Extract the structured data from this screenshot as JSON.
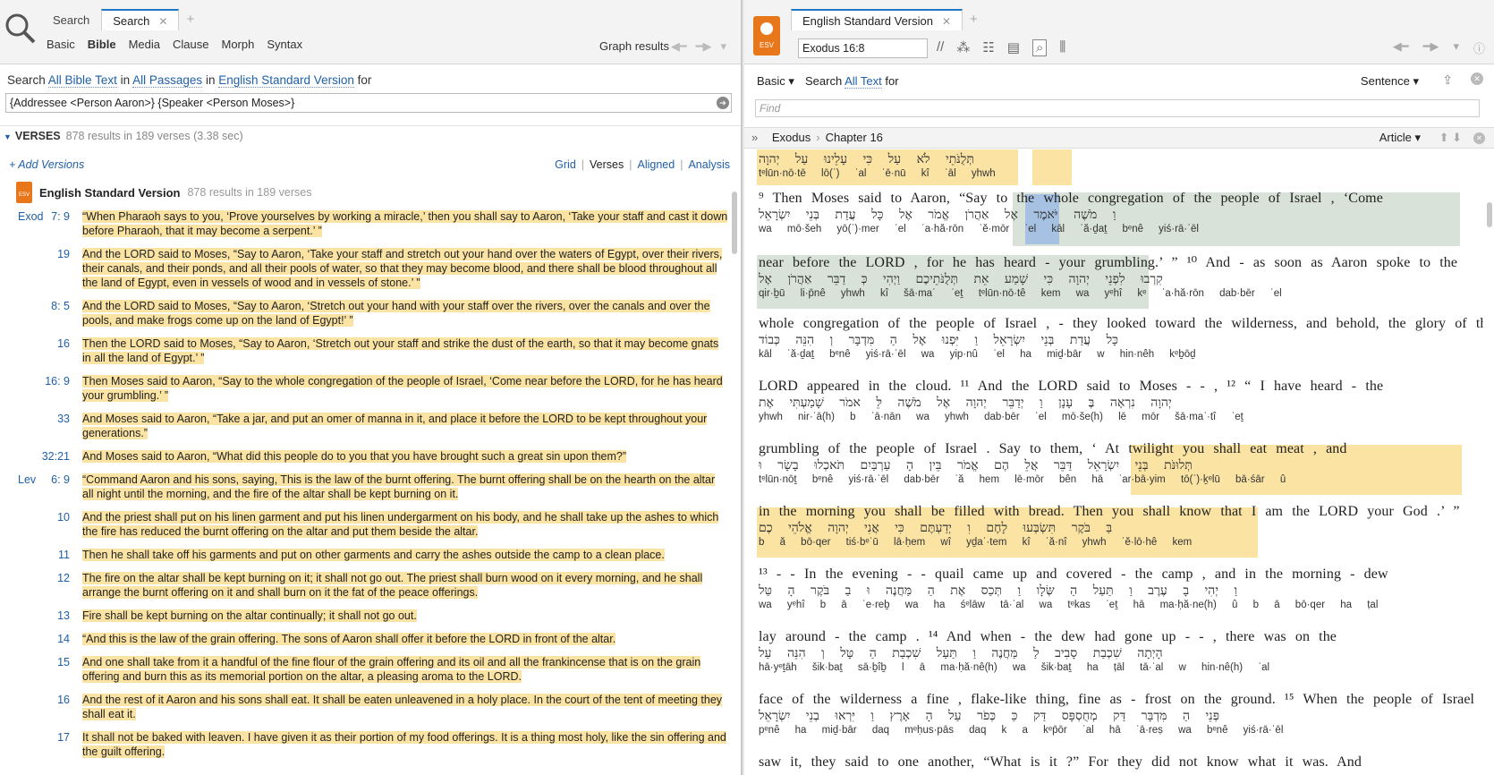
{
  "left": {
    "tabs": [
      {
        "label": "Search"
      },
      {
        "label": "Search",
        "active": true
      }
    ],
    "subnav": [
      "Basic",
      "Bible",
      "Media",
      "Clause",
      "Morph",
      "Syntax"
    ],
    "graph_results": "Graph results",
    "search_line": {
      "pre": "Search",
      "scope": "All Bible Text",
      "in": "in",
      "passages": "All Passages",
      "in2": "in",
      "version": "English Standard Version",
      "post": "for"
    },
    "query": "{Addressee <Person Aaron>} {Speaker <Person Moses>}",
    "results_header": {
      "label": "VERSES",
      "summary": "878 results in 189 verses (3.38 sec)"
    },
    "add_versions": "+ Add Versions",
    "view_modes": [
      "Grid",
      "Verses",
      "Aligned",
      "Analysis"
    ],
    "version_name": "English Standard Version",
    "version_meta": "878 results in 189 verses",
    "verses": [
      {
        "book": "Exod",
        "ref": "7: 9",
        "text": "“When Pharaoh says to you, ‘Prove yourselves by working a miracle,’ then you shall say to Aaron, ‘Take your staff and cast it down before Pharaoh, that it may become a serpent.’ ”"
      },
      {
        "book": "",
        "ref": "19",
        "text": "And the LORD said to Moses, “Say to Aaron, ‘Take your staff and stretch out your hand over the waters of Egypt, over their rivers, their canals, and their ponds, and all their pools of water, so that they may become blood, and there shall be blood throughout all the land of Egypt, even in vessels of wood and in vessels of stone.’ ”"
      },
      {
        "book": "",
        "ref": "8: 5",
        "text": "And the LORD said to Moses, “Say to Aaron, ‘Stretch out your hand with your staff over the rivers, over the canals and over the pools, and make frogs come up on the land of Egypt!’ ”"
      },
      {
        "book": "",
        "ref": "16",
        "text": "Then the LORD said to Moses, “Say to Aaron, ‘Stretch out your staff and strike the dust of the earth, so that it may become gnats in all the land of Egypt.’ ”"
      },
      {
        "book": "",
        "ref": "16: 9",
        "text": "Then Moses said to Aaron, “Say to the whole congregation of the people of Israel, ‘Come near before the LORD, for he has heard your grumbling.’ ”"
      },
      {
        "book": "",
        "ref": "33",
        "text": "And Moses said to Aaron, “Take a jar, and put an omer of manna in it, and place it before the LORD to be kept throughout your generations.”"
      },
      {
        "book": "",
        "ref": "32:21",
        "text": "And Moses said to Aaron, “What did this people do to you that you have brought such a great sin upon them?”"
      },
      {
        "book": "Lev",
        "ref": "6: 9",
        "text": "“Command Aaron and his sons, saying, This is the law of the burnt offering. The burnt offering shall be on the hearth on the altar all night until the morning, and the fire of the altar shall be kept burning on it."
      },
      {
        "book": "",
        "ref": "10",
        "text": "And the priest shall put on his linen garment and put his linen undergarment on his body, and he shall take up the ashes to which the fire has reduced the burnt offering on the altar and put them beside the altar."
      },
      {
        "book": "",
        "ref": "11",
        "text": "Then he shall take off his garments and put on other garments and carry the ashes outside the camp to a clean place."
      },
      {
        "book": "",
        "ref": "12",
        "text": "The fire on the altar shall be kept burning on it; it shall not go out. The priest shall burn wood on it every morning, and he shall arrange the burnt offering on it and shall burn on it the fat of the peace offerings."
      },
      {
        "book": "",
        "ref": "13",
        "text": "Fire shall be kept burning on the altar continually; it shall not go out."
      },
      {
        "book": "",
        "ref": "14",
        "text": "“And this is the law of the grain offering. The sons of Aaron shall offer it before the LORD in front of the altar."
      },
      {
        "book": "",
        "ref": "15",
        "text": "And one shall take from it a handful of the fine flour of the grain offering and its oil and all the frankincense that is on the grain offering and burn this as its memorial portion on the altar, a pleasing aroma to the LORD."
      },
      {
        "book": "",
        "ref": "16",
        "text": "And the rest of it Aaron and his sons shall eat. It shall be eaten unleavened in a holy place. In the court of the tent of meeting they shall eat it."
      },
      {
        "book": "",
        "ref": "17",
        "text": "It shall not be baked with leaven. I have given it as their portion of my food offerings. It is a thing most holy, like the sin offering and the guilt offering."
      }
    ]
  },
  "right": {
    "tab": "English Standard Version",
    "badge": "ESV",
    "reference": "Exodus 16:8",
    "basic": "Basic ▾",
    "search_pre": "Search",
    "search_scope": "All Text",
    "search_post": "for",
    "sentence": "Sentence ▾",
    "find_placeholder": "Find",
    "breadcrumb": {
      "book": "Exodus",
      "chapter": "Chapter 16"
    },
    "article": "Article ▾",
    "lines": [
      {
        "eng": "",
        "heb": "תְּלֻנֹּתֵי  לֹא  עַל  כִּי  עָלֵינוּ  עַל  יְהוָה",
        "trn": "tᵉlūn·nō·tē   lō(ʾ)   ʿal   ʾē·nū  kî   ʿāl   yhwh"
      },
      {
        "eng": "⁹ Then Moses  said  to  Aaron, “Say  to  the whole congregation of the people of  Israel , ‘Come",
        "heb": "וַ  מֹשֶׁה  יֹּאמֶר  אֶל  אַהֲרֹן  אֱמֹר  אֶל  כָּל  עֲדַת  בְּנֵי  יִשְׂרָאֵל",
        "trn": "wa  mō·šeh  yō(ʾ)·mer  ʾel  ʾa·hă·rōn  ʾĕ·mōr  ʾel  kāl  ʿă·ḏaṯ  bᵉnê  yiś·rā·ʾēl"
      },
      {
        "eng": "near  before  the  LORD , for he has heard  -  your grumbling.’ ” ¹⁰ And  -  as soon as Aaron spoke  to  the",
        "heb": "קִרְבוּ  לִפְנֵי  יְהוָה  כִּי  שָׁמַע  אֵת  תְּלֻנֹּתֵיכֶם  וַיְהִי  כְּ  דַבֵּר  אַהֲרֹן  אֶל",
        "trn": "qir·ḇū  li·p̄nê  yhwh  kî  šā·maʿ  ʾeṯ  tᵉlūn·nō·tê  kem  wa  yᵉhî  kᵉ  ʾa·hă·rōn  dab·bēr  ʾel"
      },
      {
        "eng": "whole congregation of the people of  Israel , - they looked toward the wilderness, and behold, the glory  of  the",
        "heb": "כָּל  עֲדַת  בְּנֵי  יִשְׂרָאֵל  וַ  יִּפְנוּ  אֶל  הַ  מִּדְבָּר  וְ  הִנֵּה  כְּבוֹד",
        "trn": "kāl  ʿă·ḏaṯ  bᵉnê  yiś·rā·ʾēl  wa  yip·nû  ʾel  ha  miḏ·bār  w  hin·nêh  kᵉḇōḏ"
      },
      {
        "eng": "LORD  appeared  in  the cloud. ¹¹ And the LORD  said  to  Moses  -  - , ¹² “ I  have  heard  -  the",
        "heb": "יְהוָה  נִרְאָה  בֶּ  עָנָן  וַ  יְדַבֵּר  יְהוָה  אֶל  מֹשֶׁה  לֵּ  אמֹר  שָׁמַעְתִּי  אֶת",
        "trn": "yhwh  nir·ʾā(h)  b  ʿā·nān  wa  yhwh  dab·bēr  ʾel  mō·še(h)  lē  mōr  šā·maʿ·tî  ʾeṯ"
      },
      {
        "eng": "grumbling of the people of  Israel . Say  to  them, ‘ At twilight  you shall  eat  meat , and",
        "heb": "תְּלוּנֹּת  בְּנֵי  יִשְׂרָאֵל  דַּבֵּר  אֲלֵ  הֶם  אֱמֹר  בֵּין  הָ  עַרְבַּיִם  תֹּאכְלוּ  בָשָׂר  וּ",
        "trn": "tᵉlūn·nōṯ  bᵉnê  yiś·rā·ʾēl  dab·bēr  ʾă  hem  lē·mōr  bên  hā  ʿar·bā·yim  tō(ʾ)·ḵᵉlū  bā·śār  û"
      },
      {
        "eng": "in the morning you shall be  filled  with bread. Then you shall  know  that  I  am the LORD  your  God .’ ”",
        "heb": "בַּ  בֹּקֶר  תִּשְׂבְּעוּ  לָחֶם  וִ  יְדַעְתֶּם  כִּי  אֲנִי  יְהוָה  אֱלֹהֵי  כֶם",
        "trn": "b  ă  bō·qer  tiś·bᵉʿū  lā·ḥem  wî  yḏaʿ·tem  kî  ʾă·nî  yhwh  ʾĕ·lō·hê  kem"
      },
      {
        "eng": "¹³  -  -  In  the evening  -  -  quail came  up  and covered  -  the  camp , and  in  the morning  -  dew",
        "heb": "וַ  יְהִי  בָ  עֶרֶב  וַ  תַּעַל  הַ  שְּׂלָו  וַ  תְּכַס  אֶת  הַ  מַּחֲנֶה  וּ  בַ  בֹּקֶר  הָ  טַּל",
        "trn": "wa  yᵉhî  b  ā  ʿe·reḇ  wa  ha  śᵉlāw  tā·ʿal  wa  tᵉkas  ʾeṯ  hā  ma·ḥă·ne(h)  û  b  ā  bō·qer  ha  ṭal"
      },
      {
        "eng": "lay      around  -  the   camp . ¹⁴ And when  -  the dew had gone  up  -  - , there was on the",
        "heb": "הָיְתָה  שִׁכְבַת  סָבִיב  לַ  מַּחֲנֶה  וַ  תַּעַל  שִׁכְבַת  הַ  טָּל  וְ  הִנֵּה  עַל",
        "trn": "hā·yᵉṯāh  šik·baṯ  sā·ḇîḇ  l  ā  ma·ḥă·nê(h)  wa  šik·baṯ  ha  ṭāl  tā·ʿal  w  hin·nê(h)  ʿal"
      },
      {
        "eng": "face  of  the wilderness  a  fine , flake-like thing, fine  as  -  frost  on  the ground. ¹⁵ When the people of  Israel",
        "heb": "פְּנֵי  הַ  מִּדְבָּר  דַּק  מְחֻסְפָּס  דַּק  כַּ  כְּפֹר  עַל  הָ  אָרֶץ  וַ  יִּרְאוּ  בְנֵי  יִשְׂרָאֵל",
        "trn": "pᵉnê  ha  miḏ·bār  daq  mᵉḥus·pās  daq  k  a  kᵉp̄ōr  ʿal  hā  ʾā·reṣ  wa  bᵉnê  yiś·rā·ʾēl"
      },
      {
        "eng": "saw  it,  they  said  to one another, “What  is  it ?” For they did  not  know  what  it  was. And",
        "heb": "",
        "trn": ""
      }
    ]
  }
}
